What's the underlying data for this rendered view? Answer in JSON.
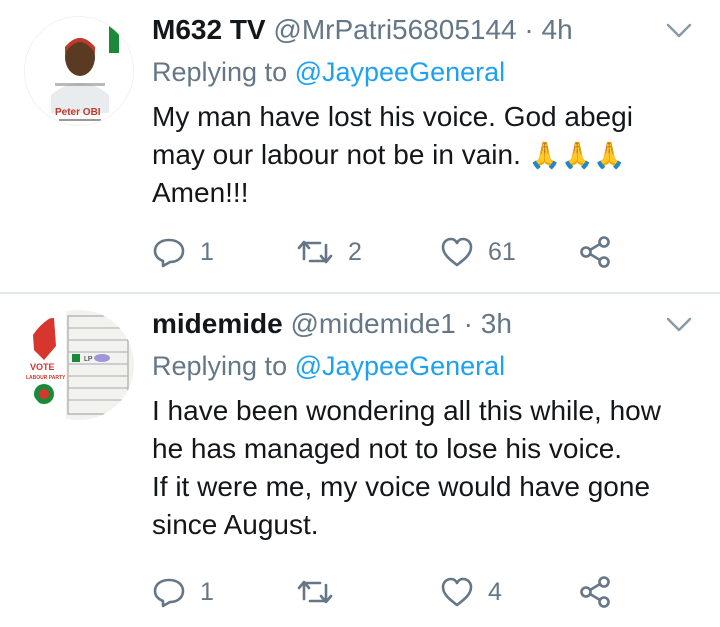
{
  "tweets": [
    {
      "name": "M632 TV",
      "handle": "@MrPatri56805144",
      "separator": "·",
      "time": "4h",
      "reply_prefix": "Replying to ",
      "reply_to": "@JaypeeGeneral",
      "body_line1": "My man have lost his voice. God abegi",
      "body_line2": "may our labour not be in vain.",
      "body_emoji": "🙏🙏🙏",
      "body_line3": "Amen!!!",
      "avatar_text": "Peter OBI",
      "reply_count": "1",
      "retweet_count": "2",
      "like_count": "61"
    },
    {
      "name": "midemide",
      "handle": "@midemide1",
      "separator": "·",
      "time": "3h",
      "reply_prefix": "Replying to ",
      "reply_to": "@JaypeeGeneral",
      "body_line1": "I have been wondering all this while, how",
      "body_line2": "he has managed not to lose his voice.",
      "body_line3": "If it were me, my voice would have gone",
      "body_line4": "since August.",
      "avatar_text1": "VOTE",
      "avatar_text2": "LABOUR PARTY",
      "avatar_text3": "LP",
      "reply_count": "1",
      "retweet_count": "",
      "like_count": "4"
    }
  ],
  "colors": {
    "text": "#14171a",
    "secondary": "#657786",
    "link": "#1da1f2",
    "divider": "#e1e8ed"
  },
  "icons": [
    "reply-icon",
    "retweet-icon",
    "like-icon",
    "share-icon",
    "chevron-down-icon"
  ]
}
